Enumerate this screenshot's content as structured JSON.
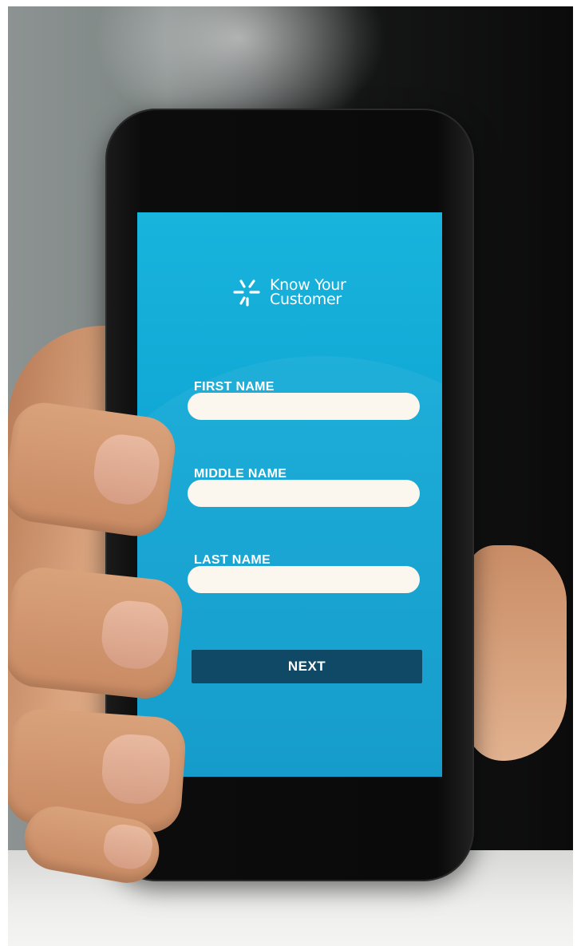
{
  "app": {
    "logo_line1": "Know Your",
    "logo_line2": "Customer",
    "logo_icon": "asterisk-burst-icon"
  },
  "form": {
    "first_name_label": "FIRST NAME",
    "first_name_value": "",
    "middle_name_label": "MIDDLE NAME",
    "middle_name_value": "",
    "last_name_label": "LAST NAME",
    "last_name_value": "",
    "next_label": "NEXT"
  },
  "colors": {
    "screen_bg": "#12a8d6",
    "input_bg": "#fbf7ee",
    "button_bg": "#0f4966",
    "text": "#ffffff"
  }
}
